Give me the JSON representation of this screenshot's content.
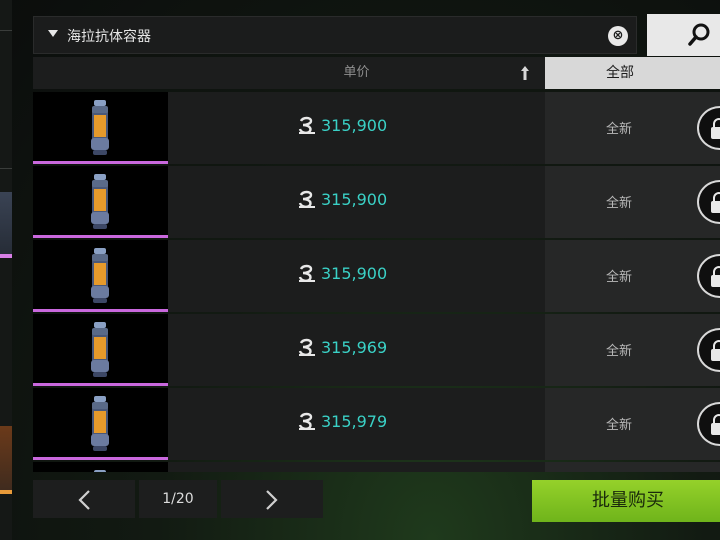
{
  "search": {
    "query": "海拉抗体容器",
    "clear_label": "⊗"
  },
  "header": {
    "price_label": "单价",
    "filter_label": "全部"
  },
  "listings": [
    {
      "price": "315,900",
      "condition": "全新"
    },
    {
      "price": "315,900",
      "condition": "全新"
    },
    {
      "price": "315,900",
      "condition": "全新"
    },
    {
      "price": "315,969",
      "condition": "全新"
    },
    {
      "price": "315,979",
      "condition": "全新"
    },
    {
      "price": "",
      "condition": ""
    }
  ],
  "pager": {
    "page_label": "1/20"
  },
  "bulk_buy_label": "批量购买",
  "colors": {
    "price": "#3ad1c6",
    "rarity": "#c968dd",
    "accent": "#8cc826"
  },
  "icons": {
    "currency": "coin-icon",
    "search": "search-icon",
    "lock": "lock-icon"
  }
}
